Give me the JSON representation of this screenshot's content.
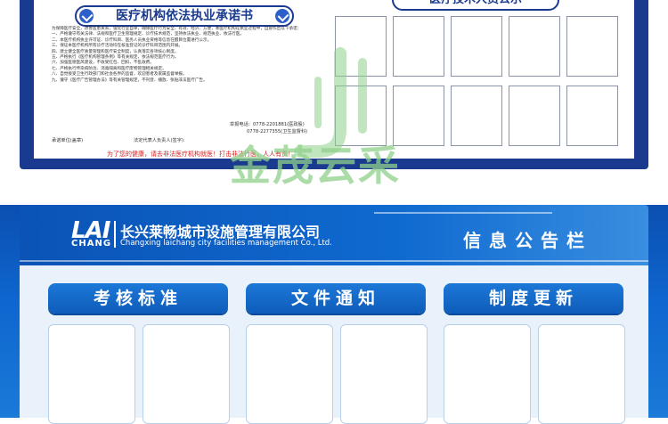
{
  "certificate": {
    "title": "医疗机构依法执业承诺书",
    "paragraphs": [
      "为保障医疗安全，改善医患关系，强化行业自律，确保医疗行为安全、有效、经济、方便，本医疗机构在执业过程中，自愿作出以下承诺：",
      "一、严格遵守有关法律、法规和医疗卫生管理规定、诊疗技术规范，坚持依法执业、规范执业、依法行医。",
      "二、本医疗机构执业许可证、诊疗科目、医务人员执业资格等信息在醒目位置进行公示。",
      "三、保证本医疗机构所有诊疗活动均在核准登记的诊疗科目范围内开展。",
      "四、建立健全医疗质量管理和医疗安全制度，认真落实各项核心制度。",
      "五、严格执行《医疗机构管理条例》等有关规定，依法规范医疗行为。",
      "六、加强医德医风建设，不收受红包、回扣，不乱收费。",
      "七、严格执行传染病防治、消毒隔离和医疗废物管理相关规定。",
      "八、自觉接受卫生行政部门和社会各界的监督，欢迎患者及家属监督举报。",
      "九、遵守《医疗广告管理办法》等有关管理规定，不刊登、播放、张贴非法医疗广告。"
    ],
    "phone_label_1": "举报电话：0778-2201881(医政股)",
    "phone_label_2": "0778-2277355(卫生监督科)",
    "signer_left": "承诺单位(盖章)",
    "signer_right": "法定代表人负责人(签字):",
    "tip": "为了您的健康，请去非法医疗机构就医！打击非法行医，人人有责！"
  },
  "tech_staff": {
    "title": "医疗技术人员公示"
  },
  "watermark": {
    "text": "金茂云采"
  },
  "company": {
    "logo_main": "LAI",
    "logo_sub": "CHANG",
    "name_cn": "长兴莱畅城市设施管理有限公司",
    "name_en": "Changxing laichang city facilities management Co., Ltd.",
    "board_title": "信息公告栏"
  },
  "sections": [
    {
      "label": "考核标准"
    },
    {
      "label": "文件通知"
    },
    {
      "label": "制度更新"
    }
  ],
  "colors": {
    "navy_frame": "#1a3a8f",
    "board_blue": "#0e66cf",
    "header_blue": "#1c78d8",
    "tip_red": "#d61f1f",
    "watermark_green": "#8fd18a"
  }
}
